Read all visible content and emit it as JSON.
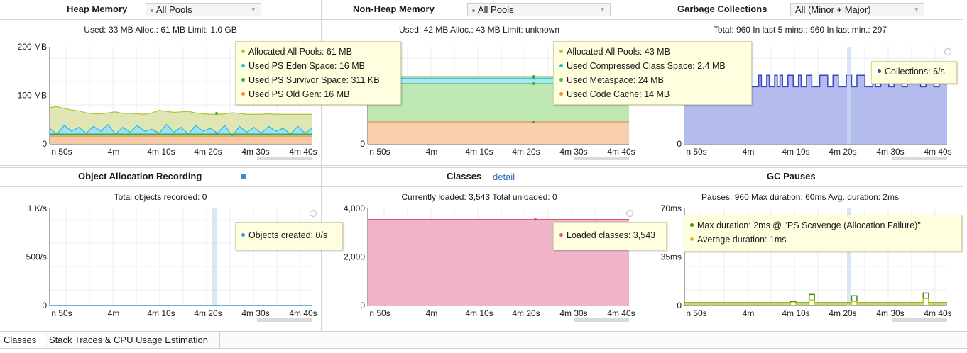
{
  "colors": {
    "eden": "#29b8e3",
    "survivor": "#3cae3c",
    "oldgen": "#ef8a3a",
    "allocated": "#b2c234",
    "metaspace": "#48c048",
    "codecache": "#ef8a3a",
    "collections": "#3a47c4",
    "loaded": "#e05582",
    "objects": "#3a9ad9",
    "maxdur": "#3f8a0f",
    "avgdur": "#c8c814",
    "accent": "#2f6fba"
  },
  "time_ticks": [
    "n 50s",
    "4m",
    "4m 10s",
    "4m 20s",
    "4m 30s",
    "4m 40s"
  ],
  "heap": {
    "title": "Heap Memory",
    "selector": "All Pools",
    "info": "Used: 33 MB  Alloc.: 61 MB  Limit: 1.0 GB",
    "yticks": [
      "200 MB",
      "100 MB",
      "0"
    ],
    "tooltip": [
      "Allocated All Pools: 61 MB",
      "Used PS Eden Space: 16 MB",
      "Used PS Survivor Space: 311 KB",
      "Used PS Old Gen: 16 MB"
    ],
    "chart_data": {
      "type": "area",
      "ylim": [
        0,
        200
      ],
      "ylabel": "MB",
      "series": [
        {
          "name": "Allocated All Pools",
          "color": "#b2c234",
          "values": [
            75,
            77,
            73,
            70,
            68,
            64,
            62,
            62,
            64,
            66,
            63,
            63,
            62,
            61,
            64,
            69,
            67,
            65,
            66,
            67,
            64,
            62,
            61,
            61,
            62,
            64,
            63,
            61,
            61,
            61,
            62,
            61,
            61,
            61,
            61,
            61,
            61
          ]
        },
        {
          "name": "Used PS Eden Space",
          "values": [
            32,
            20,
            38,
            26,
            34,
            22,
            36,
            26,
            40,
            20,
            34,
            24,
            38,
            26,
            30,
            22,
            40,
            24,
            34,
            20,
            38,
            26,
            32,
            22,
            38,
            16,
            36,
            24,
            34,
            22,
            36,
            26,
            32,
            20,
            36,
            22,
            33
          ]
        },
        {
          "name": "Used PS Survivor Space",
          "values": [
            20,
            20,
            20,
            20,
            20,
            20,
            20,
            20,
            20,
            20,
            20,
            20,
            20,
            20,
            20,
            20,
            20,
            20,
            20,
            20,
            20,
            20,
            20,
            20,
            20,
            20,
            20,
            20,
            20,
            20,
            20,
            20,
            20,
            20,
            20,
            20,
            20
          ]
        },
        {
          "name": "Used PS Old Gen",
          "values": [
            16,
            16,
            16,
            16,
            16,
            16,
            16,
            16,
            16,
            16,
            16,
            16,
            16,
            16,
            16,
            16,
            16,
            16,
            16,
            16,
            16,
            16,
            16,
            16,
            16,
            16,
            16,
            16,
            16,
            16,
            16,
            16,
            16,
            16,
            16,
            16,
            16
          ]
        }
      ]
    }
  },
  "nonheap": {
    "title": "Non-Heap Memory",
    "selector": "All Pools",
    "info": "Used: 42 MB  Alloc.: 43 MB  Limit: unknown",
    "yticks": [
      "0"
    ],
    "tooltip": [
      "Allocated All Pools: 43 MB",
      "Used Compressed Class Space: 2.4 MB",
      "Used Metaspace: 24 MB",
      "Used Code Cache: 14 MB"
    ],
    "chart_data": {
      "type": "area",
      "ylim": [
        0,
        62
      ],
      "series": [
        {
          "name": "Allocated All Pools",
          "values": [
            43,
            43,
            43,
            43,
            43,
            43,
            43,
            43,
            43,
            43,
            43,
            43,
            43,
            43,
            43,
            43,
            43,
            43,
            43,
            43,
            43,
            43,
            43,
            43,
            43,
            43,
            43,
            43,
            43,
            43,
            43,
            43,
            43,
            43,
            43,
            43,
            43
          ]
        },
        {
          "name": "Used Compressed Class Space",
          "values": [
            42,
            42,
            42,
            42,
            42,
            42,
            42,
            42,
            42,
            42,
            42,
            42,
            42,
            42,
            42,
            42,
            42,
            42,
            42,
            42,
            42,
            42,
            42,
            42,
            42,
            42,
            42,
            42,
            42,
            42,
            42,
            42,
            42,
            42,
            42,
            42,
            42
          ]
        },
        {
          "name": "Used Metaspace",
          "values": [
            38.5,
            38.5,
            38.5,
            38.5,
            38.5,
            38.5,
            38.5,
            38.5,
            38.5,
            38.5,
            38.5,
            38.5,
            38.5,
            38.5,
            38.5,
            38.5,
            38.5,
            38.5,
            38.5,
            38.5,
            38.5,
            38.5,
            38.5,
            38.5,
            38.5,
            38.5,
            38.5,
            38.5,
            38.5,
            38.5,
            38.5,
            38.5,
            38.5,
            38.5,
            38.5,
            38.5,
            38.5
          ]
        },
        {
          "name": "Used Code Cache",
          "values": [
            14,
            14,
            14,
            14,
            14,
            14,
            14,
            14,
            14,
            14,
            14,
            14,
            14,
            14,
            14,
            14,
            14,
            14,
            14,
            14,
            14,
            14,
            14,
            14,
            14,
            14,
            14,
            14,
            14,
            14,
            14,
            14,
            14,
            14,
            14,
            14,
            14
          ]
        }
      ]
    }
  },
  "gc": {
    "title": "Garbage Collections",
    "selector": "All (Minor + Major)",
    "info": "Total: 960  In last 5 mins.: 960  In last min.: 297",
    "yticks": [
      "0"
    ],
    "tooltip": [
      "Collections: 6/s"
    ],
    "chart_data": {
      "type": "area",
      "ylim": [
        0,
        8.5
      ],
      "series": [
        {
          "name": "Collections",
          "values": [
            4,
            4,
            4,
            5,
            5,
            4,
            5,
            5,
            5,
            4,
            5,
            5,
            6,
            6,
            5,
            6,
            5,
            5,
            4,
            5,
            4,
            5,
            5,
            6,
            6,
            5,
            5,
            5,
            6,
            5,
            5,
            6,
            5,
            5,
            6,
            5,
            6,
            5,
            5,
            6,
            6,
            5,
            5,
            6,
            5,
            5,
            6,
            6,
            5,
            5,
            5,
            6,
            6,
            6,
            5,
            5,
            6,
            6,
            5,
            5,
            5,
            6,
            6,
            5,
            5,
            6,
            6,
            6,
            5,
            5,
            5,
            6,
            5,
            5,
            6,
            6,
            6,
            5,
            5,
            6,
            6,
            6,
            5,
            5,
            6,
            6,
            6,
            6,
            6,
            5,
            5,
            6,
            6,
            6,
            5,
            5,
            6,
            6,
            6,
            6
          ]
        }
      ]
    }
  },
  "alloc": {
    "title": "Object Allocation Recording",
    "info": "Total objects recorded: 0",
    "yticks": [
      "1 K/s",
      "500/s",
      "0"
    ],
    "tooltip": [
      "Objects created: 0/s"
    ],
    "chart_data": {
      "type": "line",
      "ylim": [
        0,
        1000
      ],
      "series": [
        {
          "name": "Objects created",
          "values": [
            0,
            0,
            0,
            0,
            0,
            0,
            0,
            0,
            0,
            0,
            0,
            0,
            0,
            0,
            0,
            0,
            0,
            0,
            0,
            0
          ]
        }
      ]
    }
  },
  "classes": {
    "title": "Classes",
    "link": "detail",
    "info": "Currently loaded: 3,543  Total unloaded: 0",
    "yticks": [
      "4,000",
      "2,000",
      "0"
    ],
    "tooltip": [
      "Loaded classes: 3,543"
    ],
    "chart_data": {
      "type": "area",
      "ylim": [
        0,
        4000
      ],
      "series": [
        {
          "name": "Loaded classes",
          "values": [
            3543,
            3543,
            3543,
            3543,
            3543,
            3543,
            3543,
            3543,
            3543,
            3543,
            3543,
            3543,
            3543,
            3543,
            3543,
            3543,
            3543,
            3543,
            3543,
            3543
          ]
        }
      ]
    }
  },
  "gcpause": {
    "title": "GC Pauses",
    "info": "Pauses: 960  Max duration: 60ms  Avg. duration: 2ms",
    "yticks": [
      "70ms",
      "35ms",
      "0"
    ],
    "tooltip": [
      "Max duration: 2ms @ \"PS Scavenge (Allocation Failure)\"",
      "Average duration: 1ms"
    ],
    "chart_data": {
      "type": "line",
      "ylim": [
        0,
        70
      ],
      "series": [
        {
          "name": "Max duration",
          "values": [
            2,
            2,
            2,
            2,
            2,
            2,
            2,
            2,
            2,
            2,
            2,
            2,
            2,
            2,
            2,
            2,
            2,
            2,
            2,
            2,
            2,
            2,
            2,
            2,
            2,
            2,
            2,
            2,
            2,
            2,
            2,
            2,
            2,
            2,
            2,
            2,
            2,
            2,
            2,
            2,
            3,
            3,
            2,
            2,
            2,
            2,
            2,
            8,
            8,
            2,
            2,
            2,
            2,
            2,
            2,
            2,
            2,
            2,
            2,
            2,
            2,
            2,
            2,
            7,
            7,
            2,
            2,
            2,
            2,
            2,
            2,
            2,
            2,
            2,
            2,
            2,
            2,
            2,
            2,
            2,
            2,
            2,
            2,
            2,
            2,
            2,
            2,
            2,
            2,
            2,
            9,
            9,
            2,
            2,
            2,
            2,
            2,
            2,
            2,
            2
          ]
        },
        {
          "name": "Average duration",
          "values": [
            1,
            1,
            1,
            1,
            1,
            1,
            1,
            1,
            1,
            1,
            1,
            1,
            1,
            1,
            1,
            1,
            1,
            1,
            1,
            1,
            1,
            1,
            1,
            1,
            1,
            1,
            1,
            1,
            1,
            1,
            1,
            1,
            1,
            1,
            1,
            1,
            1,
            1,
            1,
            1,
            2,
            2,
            1,
            1,
            1,
            1,
            1,
            4,
            4,
            1,
            1,
            1,
            1,
            1,
            1,
            1,
            1,
            1,
            1,
            1,
            1,
            1,
            1,
            3,
            3,
            1,
            1,
            1,
            1,
            1,
            1,
            1,
            1,
            1,
            1,
            1,
            1,
            1,
            1,
            1,
            1,
            1,
            1,
            1,
            1,
            1,
            1,
            1,
            1,
            1,
            5,
            5,
            1,
            1,
            1,
            1,
            1,
            1,
            1,
            1
          ]
        }
      ]
    }
  },
  "bottom_tabs": [
    "Classes",
    "Stack Traces & CPU Usage Estimation"
  ]
}
